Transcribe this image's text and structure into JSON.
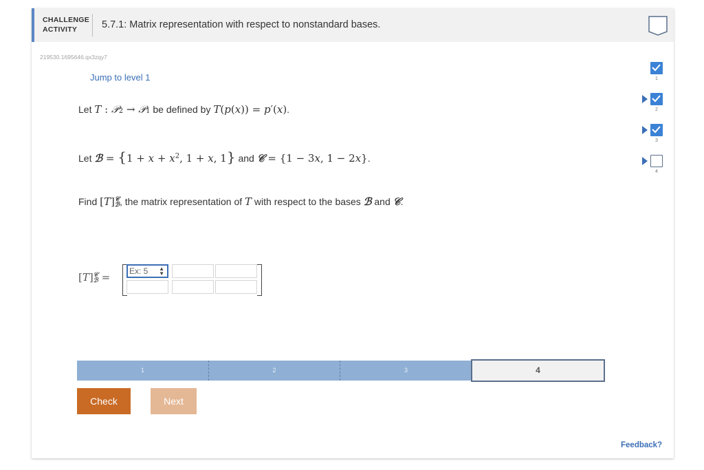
{
  "header": {
    "type_line1": "CHALLENGE",
    "type_line2": "ACTIVITY",
    "title": "5.7.1: Matrix representation with respect to nonstandard bases."
  },
  "activity_id": "219530.1695646.qx3zqy7",
  "jump_label": "Jump to level 1",
  "problem": {
    "line1_pre": "Let ",
    "line1_mid": " be defined by ",
    "line1_end": ".",
    "line2_pre": "Let ",
    "line2_and": " and ",
    "line2_end": ".",
    "line3_pre": "Find ",
    "line3_mid": ", the matrix representation of ",
    "line3_mid2": " with respect to the bases ",
    "line3_and": " and ",
    "line3_end": "."
  },
  "matrix": {
    "first_cell_placeholder": "Ex: 5"
  },
  "progress": {
    "segments": [
      "1",
      "2",
      "3",
      "4"
    ],
    "current": "4"
  },
  "buttons": {
    "check": "Check",
    "next": "Next"
  },
  "feedback": "Feedback?",
  "levels": [
    {
      "num": "1",
      "done": true
    },
    {
      "num": "2",
      "done": true
    },
    {
      "num": "3",
      "done": true
    },
    {
      "num": "4",
      "done": false
    }
  ],
  "colors": {
    "accent": "#3b6fb6",
    "check_button": "#c96b25",
    "next_button": "#e4b795",
    "progress_fill": "#8fafd4"
  }
}
